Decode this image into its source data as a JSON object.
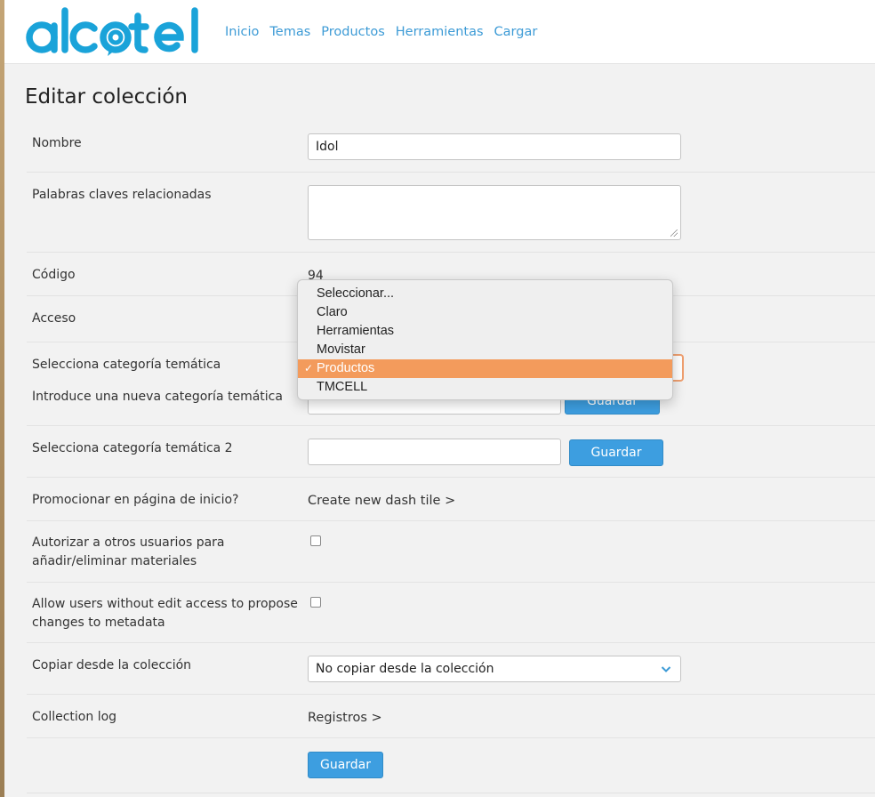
{
  "header": {
    "logo_text": "alcatel",
    "nav": [
      "Inicio",
      "Temas",
      "Productos",
      "Herramientas",
      "Cargar"
    ]
  },
  "page": {
    "title": "Editar colección"
  },
  "form": {
    "nombre": {
      "label": "Nombre",
      "value": "Idol"
    },
    "keywords": {
      "label": "Palabras claves relacionadas",
      "value": ""
    },
    "codigo": {
      "label": "Código",
      "value": "94"
    },
    "acceso": {
      "label": "Acceso"
    },
    "categoria": {
      "label": "Selecciona categoría temática"
    },
    "nueva_categoria": {
      "label": "Introduce una nueva categoría temática",
      "button": "Guardar"
    },
    "categoria2": {
      "label": "Selecciona categoría temática 2",
      "value": "",
      "button": "Guardar"
    },
    "promocionar": {
      "label": "Promocionar en página de inicio?",
      "link": "Create new dash tile >"
    },
    "autorizar": {
      "label_line1": "Autorizar a otros usuarios para",
      "label_line2": "añadir/eliminar materiales",
      "checked": false
    },
    "allow_propose": {
      "label_line1": "Allow users without edit access to propose",
      "label_line2": "changes to metadata",
      "checked": false
    },
    "copiar": {
      "label": "Copiar desde la colección",
      "selected": "No copiar desde la colección"
    },
    "log": {
      "label": "Collection log",
      "link": "Registros >"
    },
    "submit": "Guardar"
  },
  "dropdown": {
    "options": [
      "Seleccionar...",
      "Claro",
      "Herramientas",
      "Movistar",
      "Productos",
      "TMCELL"
    ],
    "selected": "Productos",
    "check": "✓"
  },
  "colors": {
    "brand": "#1aa3d9",
    "link": "#3d9bd6",
    "button": "#3d9ee0",
    "selection": "#f39b5c"
  }
}
